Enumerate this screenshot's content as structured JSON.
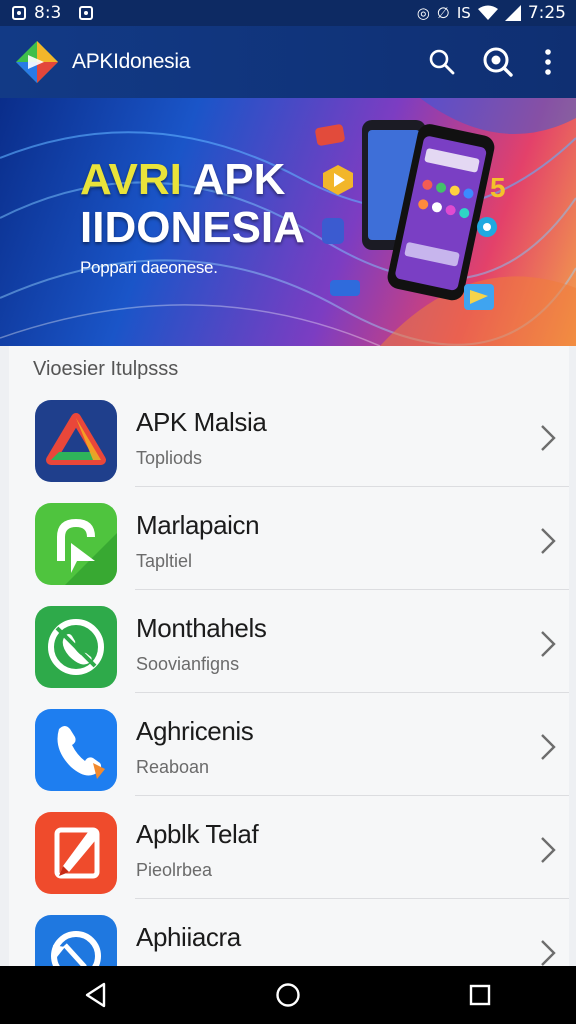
{
  "status_bar": {
    "time_left": "8:3",
    "time_right": "7:25",
    "indicator_right": "IS"
  },
  "app_bar": {
    "title": "APKIdonesia",
    "actions": [
      "search-icon",
      "zoom-search-icon",
      "more-vert-icon"
    ]
  },
  "banner": {
    "title_line1_a": "AVRI",
    "title_line1_b": "APK",
    "title_line2": "IIDONESIA",
    "subtitle": "Poppari daeonese.",
    "number_badge": "5"
  },
  "section": {
    "header": "Vioesier Itulpsss"
  },
  "apps": [
    {
      "name": "APK Malsia",
      "sub": "Topliods",
      "icon": "red-delta-icon",
      "color": "#1f3f8c"
    },
    {
      "name": "Marlapaicn",
      "sub": "Tapltiel",
      "icon": "hand-arrow-icon",
      "color": "#4fc43e"
    },
    {
      "name": "Monthahels",
      "sub": "Soovianfigns",
      "icon": "phone-circle-icon",
      "color": "#2eaa4a"
    },
    {
      "name": "Aghricenis",
      "sub": "Reaboan",
      "icon": "phone-icon",
      "color": "#1e7ef0"
    },
    {
      "name": "Apblk Telaf",
      "sub": "Pieolrbea",
      "icon": "pen-icon",
      "color": "#ef4b2c"
    },
    {
      "name": "Aphiiacra",
      "sub": "",
      "icon": "refresh-circle-icon",
      "color": "#1f78e0"
    }
  ],
  "nav": [
    "back-icon",
    "home-icon",
    "recents-icon"
  ]
}
